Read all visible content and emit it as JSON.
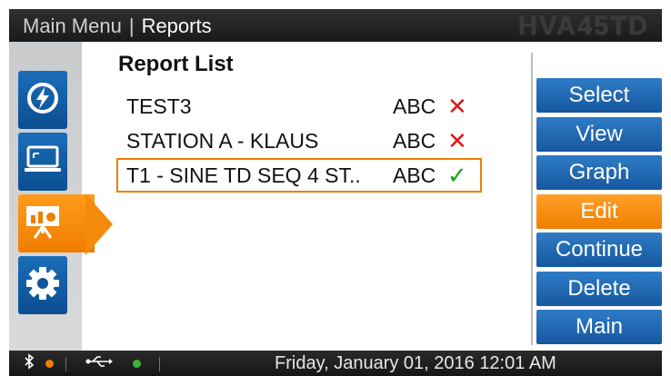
{
  "header": {
    "crumb_root": "Main Menu",
    "crumb_separator": "|",
    "crumb_current": "Reports",
    "brand": "HVA45TD"
  },
  "sidebar": {
    "items": [
      {
        "icon": "power-lightning-icon"
      },
      {
        "icon": "laptop-icon"
      },
      {
        "icon": "presentation-chart-icon",
        "active": true
      },
      {
        "icon": "gear-icon"
      }
    ]
  },
  "main": {
    "title": "Report List",
    "reports": [
      {
        "name": "TEST3",
        "operator": "ABC",
        "status": "✕",
        "ok": false
      },
      {
        "name": "STATION A - KLAUS",
        "operator": "ABC",
        "status": "✕",
        "ok": false
      },
      {
        "name": "T1 - SINE TD SEQ 4 ST..",
        "operator": "ABC",
        "status": "✓",
        "ok": true,
        "selected": true
      }
    ]
  },
  "actions": [
    {
      "label": "Select"
    },
    {
      "label": "View"
    },
    {
      "label": "Graph"
    },
    {
      "label": "Edit",
      "highlight": true
    },
    {
      "label": "Continue"
    },
    {
      "label": "Delete"
    },
    {
      "label": "Main"
    }
  ],
  "status_bar": {
    "bluetooth_icon": "bluetooth-icon",
    "usb_icon": "usb-icon",
    "datetime": "Friday, January 01, 2016 12:01 AM",
    "colors": {
      "bluetooth_dot": "#f07e00",
      "usb_dot": "#3ab53a"
    }
  }
}
